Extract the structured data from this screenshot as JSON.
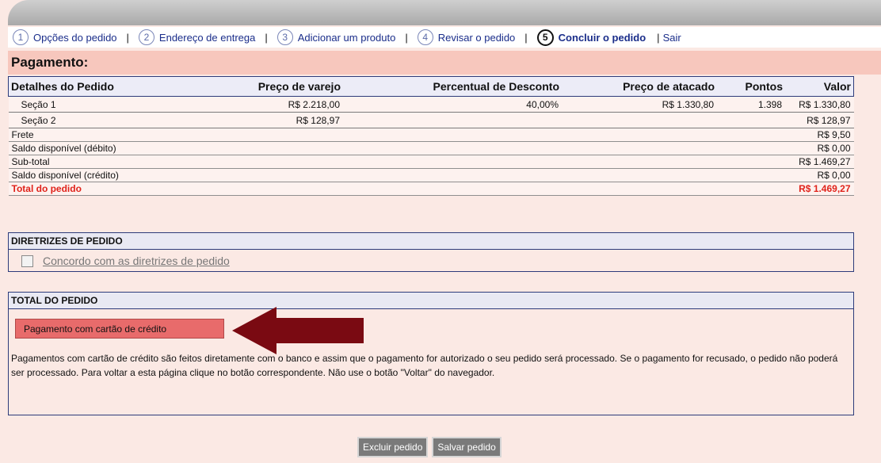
{
  "steps": [
    {
      "num": "1",
      "label": "Opções do pedido"
    },
    {
      "num": "2",
      "label": "Endereço de entrega"
    },
    {
      "num": "3",
      "label": "Adicionar um produto"
    },
    {
      "num": "4",
      "label": "Revisar o pedido"
    },
    {
      "num": "5",
      "label": "Concluir o pedido"
    }
  ],
  "exit_label": "Sair",
  "separator": "|",
  "page_title": "Pagamento:",
  "table": {
    "headers": [
      "Detalhes do Pedido",
      "Preço de varejo",
      "Percentual de Desconto",
      "Preço de atacado",
      "Pontos",
      "Valor"
    ],
    "rows": [
      {
        "label": "Seção 1",
        "retail": "R$ 2.218,00",
        "discount": "40,00%",
        "wholesale": "R$ 1.330,80",
        "points": "1.398",
        "value": "R$ 1.330,80"
      },
      {
        "label": "Seção 2",
        "retail": "R$ 128,97",
        "discount": "",
        "wholesale": "",
        "points": "",
        "value": "R$ 128,97"
      }
    ],
    "summary": [
      {
        "label": "Frete",
        "value": "R$ 9,50"
      },
      {
        "label": "Saldo disponível (débito)",
        "value": "R$ 0,00"
      },
      {
        "label": "Sub-total",
        "value": "R$ 1.469,27"
      },
      {
        "label": "Saldo disponível (crédito)",
        "value": "R$ 0,00"
      }
    ],
    "total": {
      "label": "Total do pedido",
      "value": "R$ 1.469,27"
    }
  },
  "guidelines": {
    "title": "DIRETRIZES DE PEDIDO",
    "checkbox_label": "Concordo com as diretrizes de pedido"
  },
  "order_total": {
    "title": "TOTAL DO PEDIDO",
    "pay_button": "Pagamento com cartão de crédito",
    "notice": "Pagamentos com cartão de crédito são feitos diretamente com o banco e assim que o pagamento for autorizado o seu pedido será processado. Se o pagamento for recusado, o pedido não poderá ser processado. Para voltar a esta página clique no botão correspondente. Não use o botão \"Voltar\" do navegador."
  },
  "actions": {
    "delete": "Excluir pedido",
    "save": "Salvar pedido"
  },
  "colors": {
    "accent": "#1a2d8a",
    "title_bg": "#f7c7bd",
    "total_red": "#e0231b",
    "arrow": "#7a0a12"
  }
}
